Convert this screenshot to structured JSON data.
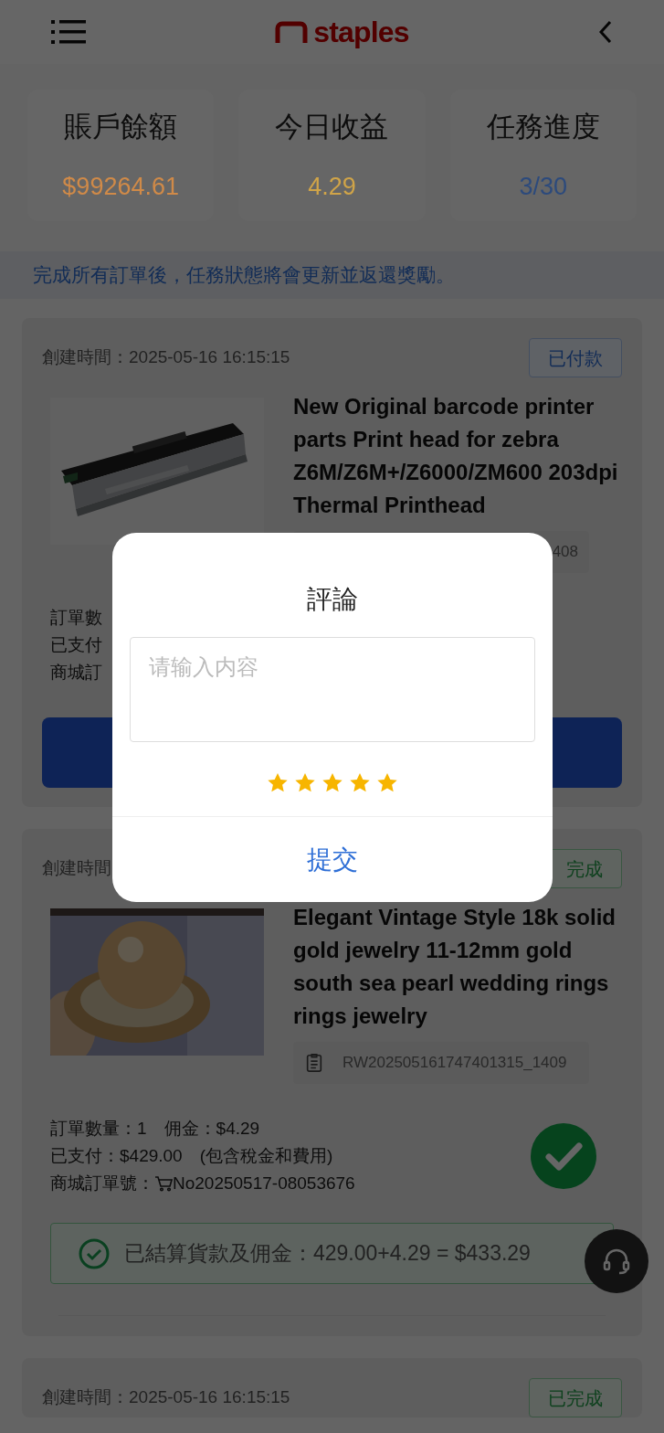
{
  "header": {
    "logo": "staples"
  },
  "stats": [
    {
      "label": "賬戶餘額",
      "value": "$99264.61",
      "color": "#d08a48"
    },
    {
      "label": "今日收益",
      "value": "4.29",
      "color": "#d0a448"
    },
    {
      "label": "任務進度",
      "value": "3/30",
      "color": "#2c4a7c"
    }
  ],
  "notice": "完成所有訂單後，任務狀態將會更新並返還獎勵。",
  "orders": [
    {
      "time": "創建時間：2025-05-16 16:15:15",
      "status": {
        "label": "已付款",
        "kind": "paid"
      },
      "title": "New Original barcode printer parts Print head for zebra Z6M/Z6M+/Z6000/ZM600 203dpi Thermal Printhead",
      "order_id": "408",
      "id_icon": false,
      "details": [
        {
          "kind": "plain",
          "text": "訂單數"
        },
        {
          "kind": "plain",
          "text": "已支付"
        },
        {
          "kind": "plain",
          "text": "商城訂"
        }
      ],
      "completed": false,
      "pay_button": true
    },
    {
      "time": "創建時間",
      "status": {
        "label": "完成",
        "kind": "done"
      },
      "title": "Elegant Vintage Style 18k solid gold jewelry 11-12mm gold south sea pearl wedding rings rings jewelry",
      "order_id": "RW202505161747401315_1409",
      "id_icon": true,
      "details": [
        {
          "kind": "plain",
          "text": "訂單數量：1　佣金：$4.29"
        },
        {
          "kind": "plain",
          "text": "已支付：$429.00　(包含稅金和費用)"
        },
        {
          "kind": "cart",
          "label": "商城訂單號：",
          "text": "No20250517-08053676"
        }
      ],
      "completed": true,
      "pay_button": false,
      "settlement": "已結算貨款及佣金：429.00+4.29 = $433.29"
    },
    {
      "time": "創建時間：2025-05-16 16:15:15",
      "status": {
        "label": "已完成",
        "kind": "done"
      }
    }
  ],
  "modal": {
    "title": "評論",
    "placeholder": "请输入内容",
    "stars": 5,
    "submit": "提交"
  }
}
